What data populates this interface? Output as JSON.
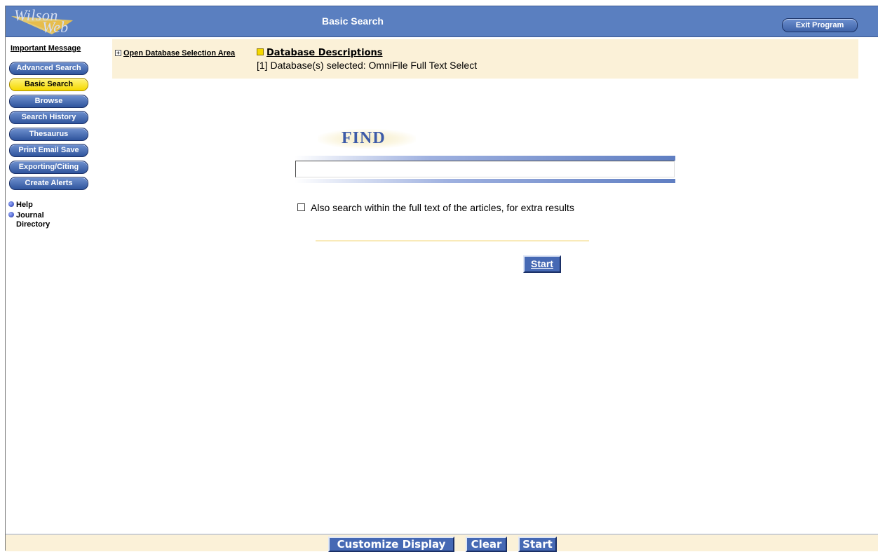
{
  "header": {
    "logo_line1": "Wilson",
    "logo_line2": "Web",
    "title": "Basic Search",
    "exit_label": "Exit Program"
  },
  "sidebar": {
    "important_message": "Important Message",
    "buttons": [
      {
        "label": "Advanced Search",
        "active": false
      },
      {
        "label": "Basic Search",
        "active": true
      },
      {
        "label": "Browse",
        "active": false
      },
      {
        "label": "Search History",
        "active": false
      },
      {
        "label": "Thesaurus",
        "active": false
      },
      {
        "label": "Print Email Save",
        "active": false
      },
      {
        "label": "Exporting/Citing",
        "active": false
      },
      {
        "label": "Create Alerts",
        "active": false
      }
    ],
    "links": [
      {
        "label": "Help",
        "icon": "bullet-icon"
      },
      {
        "label": "Journal Directory",
        "icon": "bullet-icon"
      }
    ]
  },
  "database": {
    "open_area_label": "Open Database Selection Area",
    "descriptions_label": "Database Descriptions",
    "selected_text": "[1] Database(s) selected: OmniFile Full Text Select"
  },
  "search": {
    "find_label": "FIND",
    "query_value": "",
    "fulltext_label": "Also search within the full text of the articles, for extra results",
    "fulltext_checked": false,
    "start_label": "Start"
  },
  "bottom": {
    "customize_label": "Customize Display",
    "clear_label": "Clear",
    "start_label": "Start"
  },
  "colors": {
    "header_blue": "#5a7fc0",
    "button_blue": "#4669b4",
    "active_yellow": "#f5d800",
    "bar_cream": "#fbf1d8"
  }
}
